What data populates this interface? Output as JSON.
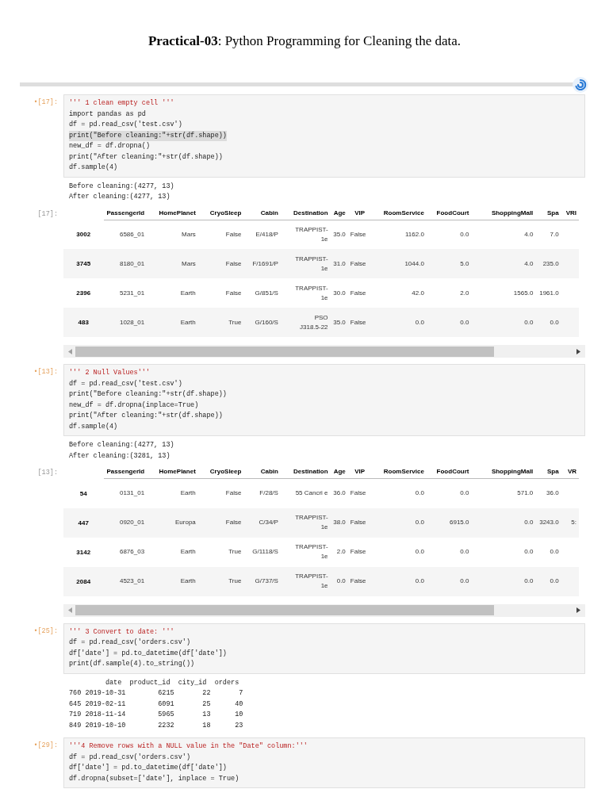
{
  "title": "**Practical-03**: Python Programming for Cleaning the data.",
  "cells": [
    {
      "prompt": "•[17]:",
      "code": [
        {
          "text": "''' 1 clean empty cell '''",
          "kind": "docstring",
          "highlighted": false
        },
        {
          "text": "import pandas as pd",
          "kind": "code",
          "highlighted": false
        },
        {
          "text": "df = pd.read_csv('test.csv')",
          "kind": "code",
          "highlighted": false
        },
        {
          "text": "print(\"Before cleaning:\"+str(df.shape))",
          "kind": "code",
          "highlighted": true
        },
        {
          "text": "new_df = df.dropna()",
          "kind": "code",
          "highlighted": false
        },
        {
          "text": "print(\"After cleaning:\"+str(df.shape))",
          "kind": "code",
          "highlighted": false
        },
        {
          "text": "df.sample(4)",
          "kind": "code",
          "highlighted": false
        }
      ],
      "output": [
        "Before cleaning:(4277, 13)",
        "After cleaning:(4277, 13)"
      ],
      "table": {
        "prompt": "[17]:",
        "columns": [
          "PassengerId",
          "HomePlanet",
          "CryoSleep",
          "Cabin",
          "Destination",
          "Age",
          "VIP",
          "RoomService",
          "FoodCourt",
          "ShoppingMall",
          "Spa",
          "VRI"
        ],
        "rows": [
          {
            "index": "3002",
            "cells": [
              "6586_01",
              "Mars",
              "False",
              "E/418/P",
              "TRAPPIST-1e",
              "35.0",
              "False",
              "1162.0",
              "0.0",
              "4.0",
              "7.0"
            ]
          },
          {
            "index": "3745",
            "cells": [
              "8180_01",
              "Mars",
              "False",
              "F/1691/P",
              "TRAPPIST-1e",
              "31.0",
              "False",
              "1044.0",
              "5.0",
              "4.0",
              "235.0"
            ]
          },
          {
            "index": "2396",
            "cells": [
              "5231_01",
              "Earth",
              "False",
              "G/851/S",
              "TRAPPIST-1e",
              "30.0",
              "False",
              "42.0",
              "2.0",
              "1565.0",
              "1961.0"
            ]
          },
          {
            "index": "483",
            "cells": [
              "1028_01",
              "Earth",
              "True",
              "G/160/S",
              "PSO J318.5-22",
              "35.0",
              "False",
              "0.0",
              "0.0",
              "0.0",
              "0.0"
            ]
          }
        ]
      }
    },
    {
      "prompt": "•[13]:",
      "code": [
        {
          "text": "''' 2 Null Values'''",
          "kind": "docstring",
          "highlighted": false
        },
        {
          "text": "df = pd.read_csv('test.csv')",
          "kind": "code",
          "highlighted": false
        },
        {
          "text": "print(\"Before cleaning:\"+str(df.shape))",
          "kind": "code",
          "highlighted": false
        },
        {
          "text": "new_df = df.dropna(inplace=True)",
          "kind": "code",
          "highlighted": false
        },
        {
          "text": "print(\"After cleaning:\"+str(df.shape))",
          "kind": "code",
          "highlighted": false
        },
        {
          "text": "df.sample(4)",
          "kind": "code",
          "highlighted": false
        }
      ],
      "output": [
        "Before cleaning:(4277, 13)",
        "After cleaning:(3281, 13)"
      ],
      "table": {
        "prompt": "[13]:",
        "columns": [
          "PassengerId",
          "HomePlanet",
          "CryoSleep",
          "Cabin",
          "Destination",
          "Age",
          "VIP",
          "RoomService",
          "FoodCourt",
          "ShoppingMall",
          "Spa",
          "VR"
        ],
        "rows": [
          {
            "index": "54",
            "cells": [
              "0131_01",
              "Earth",
              "False",
              "F/28/S",
              "55 Cancri e",
              "36.0",
              "False",
              "0.0",
              "0.0",
              "571.0",
              "36.0"
            ]
          },
          {
            "index": "447",
            "cells": [
              "0920_01",
              "Europa",
              "False",
              "C/34/P",
              "TRAPPIST-1e",
              "38.0",
              "False",
              "0.0",
              "6915.0",
              "0.0",
              "3243.0",
              "5:"
            ]
          },
          {
            "index": "3142",
            "cells": [
              "6876_03",
              "Earth",
              "True",
              "G/1118/S",
              "TRAPPIST-1e",
              "2.0",
              "False",
              "0.0",
              "0.0",
              "0.0",
              "0.0"
            ]
          },
          {
            "index": "2084",
            "cells": [
              "4523_01",
              "Earth",
              "True",
              "G/737/S",
              "TRAPPIST-1e",
              "0.0",
              "False",
              "0.0",
              "0.0",
              "0.0",
              "0.0"
            ]
          }
        ]
      }
    },
    {
      "prompt": "•[25]:",
      "code": [
        {
          "text": "''' 3 Convert to date: '''",
          "kind": "docstring",
          "highlighted": false
        },
        {
          "text": "df = pd.read_csv('orders.csv')",
          "kind": "code",
          "highlighted": false
        },
        {
          "text": "df['date'] = pd.to_datetime(df['date'])",
          "kind": "code",
          "highlighted": false
        },
        {
          "text": "print(df.sample(4).to_string())",
          "kind": "code",
          "highlighted": false
        }
      ],
      "output": [
        "         date  product_id  city_id  orders",
        "760 2019-10-31        6215       22       7",
        "645 2019-02-11        6091       25      40",
        "719 2018-11-14        5965       13      10",
        "849 2019-10-10        2232       18      23"
      ]
    },
    {
      "prompt": "•[29]:",
      "code": [
        {
          "text": "'''4 Remove rows with a NULL value in the \"Date\" column:'''",
          "kind": "docstring",
          "highlighted": false
        },
        {
          "text": "df = pd.read_csv('orders.csv')",
          "kind": "code",
          "highlighted": false
        },
        {
          "text": "df['date'] = pd.to_datetime(df['date'])",
          "kind": "code",
          "highlighted": false
        },
        {
          "text": "df.dropna(subset=['date'], inplace = True)",
          "kind": "code",
          "highlighted": false
        }
      ]
    }
  ]
}
